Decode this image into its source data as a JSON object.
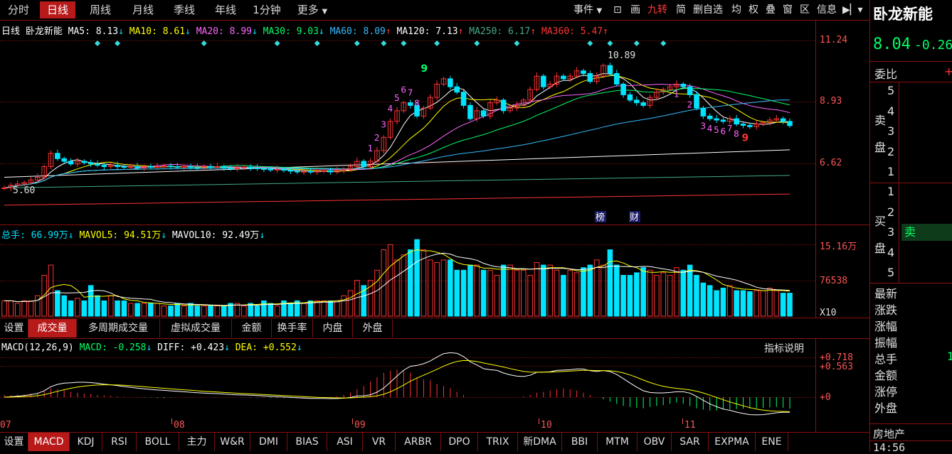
{
  "period_tabs": [
    {
      "label": "分时",
      "active": false
    },
    {
      "label": "日线",
      "active": true
    },
    {
      "label": "周线",
      "active": false
    },
    {
      "label": "月线",
      "active": false
    },
    {
      "label": "季线",
      "active": false
    },
    {
      "label": "年线",
      "active": false
    },
    {
      "label": "1分钟",
      "active": false
    },
    {
      "label": "更多",
      "active": false
    }
  ],
  "toolbar": [
    "事件",
    "画",
    "九转",
    "简",
    "删自选",
    "均",
    "权",
    "叠",
    "窗",
    "区",
    "信息"
  ],
  "stock": {
    "name": "卧龙新能",
    "price": "8.04",
    "change": "-0.26"
  },
  "kline_legend": [
    {
      "text": "日线 卧龙新能",
      "color": "#ffffff",
      "arrow": "",
      "arrow_color": ""
    },
    {
      "text": "MA5: 8.13",
      "color": "#ffffff",
      "arrow": "↓",
      "arrow_color": "#00e5ff"
    },
    {
      "text": "MA10: 8.61",
      "color": "#ffff00",
      "arrow": "↓",
      "arrow_color": "#00e5ff"
    },
    {
      "text": "MA20: 8.99",
      "color": "#ff66ff",
      "arrow": "↓",
      "arrow_color": "#00e5ff"
    },
    {
      "text": "MA30: 9.03",
      "color": "#00ff66",
      "arrow": "↓",
      "arrow_color": "#00e5ff"
    },
    {
      "text": "MA60: 8.09",
      "color": "#33bbff",
      "arrow": "↑",
      "arrow_color": "#ff3333"
    },
    {
      "text": "MA120: 7.13",
      "color": "#ffffff",
      "arrow": "↑",
      "arrow_color": "#ff3333"
    },
    {
      "text": "MA250: 6.17",
      "color": "#44aa88",
      "arrow": "↑",
      "arrow_color": "#ff3333"
    },
    {
      "text": "MA360: 5.47",
      "color": "#ff3333",
      "arrow": "↑",
      "arrow_color": "#ff3333"
    }
  ],
  "price_axis": [
    "11.24",
    "8.93",
    "6.62"
  ],
  "price_annotations": {
    "high": "10.89",
    "low": "5.60"
  },
  "badges": [
    "榜",
    "财"
  ],
  "vol_legend": [
    {
      "text": "总手: 66.99万",
      "color": "#00e5ff",
      "arrow": "↓"
    },
    {
      "text": "MAVOL5: 94.51万",
      "color": "#ffff00",
      "arrow": "↓"
    },
    {
      "text": "MAVOL10: 92.49万",
      "color": "#ffffff",
      "arrow": "↓"
    }
  ],
  "vol_axis": [
    "15.16万",
    "76538",
    "X10"
  ],
  "vol_tabs": [
    "设置",
    "成交量",
    "多周期成交量",
    "虚拟成交量",
    "金额",
    "换手率",
    "内盘",
    "外盘"
  ],
  "macd_legend": [
    {
      "text": "MACD(12,26,9)",
      "color": "#ffffff",
      "arrow": ""
    },
    {
      "text": "MACD: -0.258",
      "color": "#00ff66",
      "arrow": "↓"
    },
    {
      "text": "DIFF: +0.423",
      "color": "#ffffff",
      "arrow": "↓"
    },
    {
      "text": "DEA: +0.552",
      "color": "#ffff00",
      "arrow": "↓"
    }
  ],
  "macd_help": "指标说明",
  "macd_axis": [
    "+0.718",
    "+0.563",
    "+0"
  ],
  "date_axis": [
    "07",
    "08",
    "09",
    "10",
    "11"
  ],
  "indicator_tabs": [
    "设置",
    "MACD",
    "KDJ",
    "RSI",
    "BOLL",
    "主力",
    "W&R",
    "DMI",
    "BIAS",
    "ASI",
    "VR",
    "ARBR",
    "DPO",
    "TRIX",
    "新DMA",
    "BBI",
    "MTM",
    "OBV",
    "SAR",
    "EXPMA",
    "ENE"
  ],
  "right_panel": {
    "order_book_title": "委比",
    "sell_label": [
      "卖",
      "盘"
    ],
    "buy_label": [
      "买",
      "盘"
    ],
    "sell_levels": [
      "5",
      "4",
      "3",
      "2",
      "1"
    ],
    "buy_levels": [
      "1",
      "2",
      "3",
      "4",
      "5"
    ],
    "buy3_badge": "卖",
    "stats": [
      "最新",
      "涨跌",
      "涨幅",
      "振幅",
      "总手",
      "金额",
      "涨停",
      "外盘"
    ],
    "stat_partial": "1",
    "sector": "房地产",
    "time": "14:56"
  },
  "chart_data": {
    "type": "candlestick",
    "title": "日线 卧龙新能",
    "y_ticks": [
      11.24,
      8.93,
      6.62
    ],
    "months": [
      "07",
      "08",
      "09",
      "10",
      "11"
    ],
    "high": 10.89,
    "low": 5.6,
    "ma": {
      "MA5": 8.13,
      "MA10": 8.61,
      "MA20": 8.99,
      "MA30": 9.03,
      "MA60": 8.09,
      "MA120": 7.13,
      "MA250": 6.17,
      "MA360": 5.47
    },
    "closes": [
      5.7,
      5.8,
      5.85,
      5.9,
      6.0,
      6.1,
      6.5,
      7.0,
      6.8,
      6.7,
      6.6,
      6.7,
      6.65,
      6.6,
      6.55,
      6.5,
      6.55,
      6.5,
      6.48,
      6.5,
      6.45,
      6.5,
      6.48,
      6.5,
      6.52,
      6.5,
      6.48,
      6.5,
      6.47,
      6.45,
      6.5,
      6.48,
      6.5,
      6.45,
      6.42,
      6.45,
      6.48,
      6.45,
      6.42,
      6.4,
      6.38,
      6.4,
      6.36,
      6.33,
      6.3,
      6.32,
      6.3,
      6.33,
      6.35,
      6.3,
      6.35,
      6.4,
      6.5,
      6.7,
      6.5,
      6.7,
      7.1,
      7.6,
      8.2,
      8.6,
      8.9,
      8.8,
      8.4,
      8.7,
      9.1,
      9.6,
      9.8,
      9.5,
      9.3,
      8.8,
      8.3,
      8.6,
      8.4,
      8.9,
      9.0,
      8.6,
      8.7,
      8.8,
      9.0,
      9.4,
      9.9,
      9.5,
      9.6,
      9.9,
      9.8,
      9.9,
      10.1,
      10.0,
      9.7,
      9.9,
      10.3,
      10.0,
      9.6,
      9.2,
      9.0,
      8.9,
      8.8,
      9.1,
      9.3,
      9.4,
      9.5,
      9.6,
      9.5,
      9.2,
      8.7,
      8.4,
      8.3,
      8.25,
      8.2,
      8.3,
      8.1,
      8.05,
      8.0,
      8.1,
      8.15,
      8.25,
      8.3,
      8.2,
      8.04
    ],
    "volume_wan": [
      3,
      3,
      2.5,
      3,
      3,
      4,
      8,
      10,
      5,
      4,
      3,
      3.5,
      3,
      6,
      4,
      3,
      4,
      3,
      3,
      2.5,
      2.5,
      2.5,
      2.5,
      2.5,
      2,
      2,
      2.5,
      2,
      2.5,
      2,
      2,
      2,
      2,
      2,
      2.5,
      2.5,
      2,
      2.5,
      2,
      3,
      2.5,
      2,
      3,
      2.5,
      3,
      2.5,
      3,
      3,
      3,
      3,
      3,
      4,
      5,
      7,
      6,
      7,
      9,
      13,
      14,
      11,
      12,
      13,
      15,
      13,
      11,
      10.5,
      11,
      11,
      9,
      9,
      10,
      10,
      9,
      9,
      8,
      10,
      10,
      9,
      9,
      8,
      10.5,
      10,
      10,
      9,
      8,
      9,
      8.5,
      9.5,
      10,
      11,
      10,
      13,
      10,
      8,
      8,
      8.5,
      9.5,
      9,
      8,
      8.5,
      8,
      9.5,
      9,
      10,
      8,
      6.5,
      6,
      5,
      5.5,
      6,
      5,
      5,
      4.8,
      5,
      5,
      5.5,
      5,
      4.5,
      4.5
    ],
    "macd_hist": [
      0.05,
      0.05,
      0.06,
      0.06,
      0.08,
      0.1,
      0.15,
      0.2,
      0.18,
      0.15,
      0.12,
      0.1,
      0.08,
      0.07,
      0.05,
      0.04,
      0.03,
      0.02,
      0.01,
      0,
      0,
      -0.01,
      -0.01,
      -0.02,
      -0.02,
      -0.01,
      0,
      0,
      0,
      0,
      0,
      0,
      0,
      0,
      0,
      0,
      0,
      -0.01,
      -0.01,
      -0.01,
      -0.02,
      -0.02,
      -0.02,
      -0.02,
      -0.01,
      -0.01,
      0,
      0,
      0,
      0.01,
      0.02,
      0.05,
      0.1,
      0.18,
      0.25,
      0.35,
      0.45,
      0.55,
      0.6,
      0.62,
      0.6,
      0.55,
      0.45,
      0.4,
      0.38,
      0.3,
      0.25,
      0.2,
      0.12,
      0.05,
      0,
      0,
      0,
      0,
      0,
      0,
      0,
      0,
      0.02,
      0.05,
      0.1,
      0.12,
      0.15,
      0.18,
      0.2,
      0.18,
      0.15,
      0.1,
      0.05,
      0,
      -0.05,
      -0.1,
      -0.15,
      -0.2,
      -0.22,
      -0.24,
      -0.25,
      -0.22,
      -0.2,
      -0.18,
      -0.15,
      -0.12,
      -0.15,
      -0.2,
      -0.25,
      -0.28,
      -0.3,
      -0.3,
      -0.28,
      -0.27,
      -0.27,
      -0.26,
      -0.26,
      -0.25,
      -0.24,
      -0.23,
      -0.22,
      -0.24,
      -0.258
    ]
  }
}
